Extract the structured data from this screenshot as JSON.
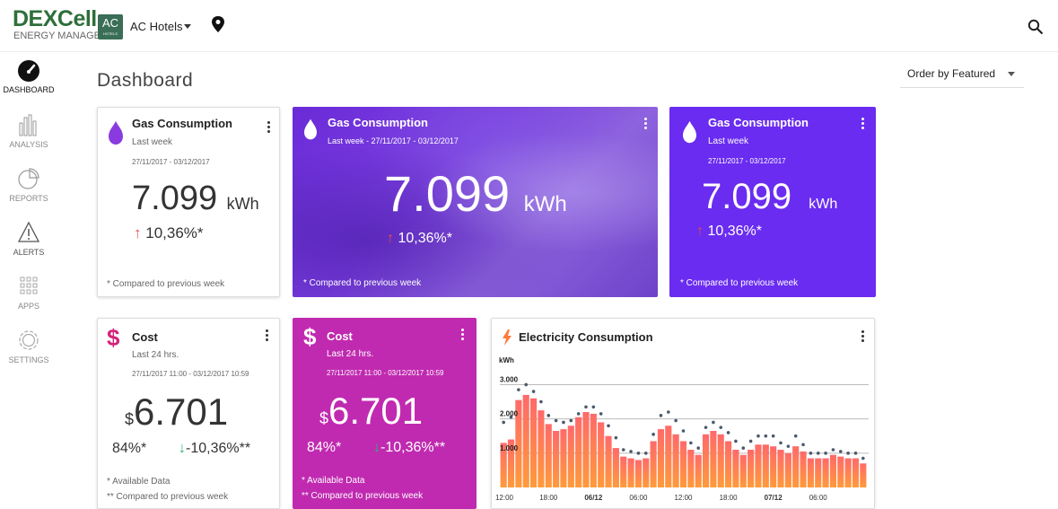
{
  "header": {
    "logo_main": "DEXCell",
    "logo_sub": "ENERGY MANAGER",
    "hotel_logo_text": "AC",
    "hotel_logo_small": "HOTELS",
    "hotel_name": "AC Hotels"
  },
  "sidebar": {
    "items": [
      {
        "label": "DASHBOARD",
        "icon": "speedometer-icon"
      },
      {
        "label": "ANALYSIS",
        "icon": "bar-chart-icon"
      },
      {
        "label": "REPORTS",
        "icon": "pie-chart-icon"
      },
      {
        "label": "ALERTS",
        "icon": "warning-icon"
      },
      {
        "label": "APPS",
        "icon": "grid-icon"
      },
      {
        "label": "SETTINGS",
        "icon": "gear-icon"
      }
    ]
  },
  "page": {
    "title": "Dashboard",
    "order_by": "Order by Featured"
  },
  "gas_cards": [
    {
      "title": "Gas Consumption",
      "period": "Last week",
      "dates": "27/11/2017 - 03/12/2017",
      "value": "7.099",
      "unit": "kWh",
      "change": "10,36%*",
      "note": "* Compared to previous week"
    },
    {
      "title": "Gas Consumption",
      "period": "Last week - 27/11/2017 - 03/12/2017",
      "value": "7.099",
      "unit": "kWh",
      "change": "10,36%*",
      "note": "* Compared to previous week"
    },
    {
      "title": "Gas Consumption",
      "period": "Last week",
      "dates": "27/11/2017 - 03/12/2017",
      "value": "7.099",
      "unit": "kWh",
      "change": "10,36%*",
      "note": "* Compared to previous week"
    }
  ],
  "cost_cards": [
    {
      "title": "Cost",
      "period": "Last 24 hrs.",
      "dates": "27/11/2017 11:00 - 03/12/2017 10:59",
      "currency": "$",
      "value": "6.701",
      "available": "84%*",
      "change": "-10,36%**",
      "note1": "* Available Data",
      "note2": "** Compared to previous week"
    },
    {
      "title": "Cost",
      "period": "Last 24 hrs.",
      "dates": "27/11/2017 11:00 - 03/12/2017 10:59",
      "currency": "$",
      "value": "6.701",
      "available": "84%*",
      "change": "-10,36%**",
      "note1": "* Available Data",
      "note2": "** Compared to previous week"
    }
  ],
  "electricity": {
    "title": "Electricity Consumption"
  },
  "chart_data": {
    "type": "bar",
    "title": "Electricity Consumption",
    "ylabel": "kWh",
    "ylim": [
      0,
      3300
    ],
    "yticks": [
      "1.000",
      "2.000",
      "3.000"
    ],
    "ytick_values": [
      1000,
      2000,
      3000
    ],
    "xticks": [
      {
        "label": "12:00",
        "index": 0,
        "bold": false
      },
      {
        "label": "18:00",
        "index": 6,
        "bold": false
      },
      {
        "label": "06/12",
        "index": 12,
        "bold": true
      },
      {
        "label": "06:00",
        "index": 18,
        "bold": false
      },
      {
        "label": "12:00",
        "index": 24,
        "bold": false
      },
      {
        "label": "18:00",
        "index": 30,
        "bold": false
      },
      {
        "label": "07/12",
        "index": 36,
        "bold": true
      },
      {
        "label": "06:00",
        "index": 42,
        "bold": false
      }
    ],
    "bar_color": "#ff6a6a",
    "bar_color_bottom": "#ff9a3c",
    "dot_color": "#4a5a6a",
    "series": [
      {
        "kind": "bar",
        "values": [
          1300,
          1400,
          2550,
          2700,
          2600,
          2250,
          1850,
          1650,
          1700,
          1800,
          2050,
          2200,
          2150,
          1900,
          1500,
          1150,
          900,
          850,
          800,
          850,
          1350,
          1700,
          1800,
          1550,
          1350,
          1100,
          950,
          1550,
          1650,
          1550,
          1350,
          1100,
          950,
          1100,
          1250,
          1250,
          1200,
          1100,
          1000,
          1200,
          1050,
          850,
          850,
          850,
          950,
          900,
          850,
          850,
          700
        ]
      },
      {
        "kind": "dot",
        "values": [
          1900,
          2050,
          2850,
          3000,
          2800,
          2500,
          2100,
          1950,
          1900,
          1950,
          2150,
          2350,
          2350,
          2150,
          1800,
          1450,
          1100,
          1050,
          1000,
          1000,
          1550,
          2100,
          2200,
          1950,
          1650,
          1300,
          1150,
          1750,
          1900,
          1750,
          1600,
          1350,
          1150,
          1350,
          1500,
          1500,
          1500,
          1300,
          1200,
          1500,
          1250,
          1000,
          1000,
          1000,
          1100,
          1050,
          1000,
          1000,
          850
        ]
      }
    ]
  }
}
